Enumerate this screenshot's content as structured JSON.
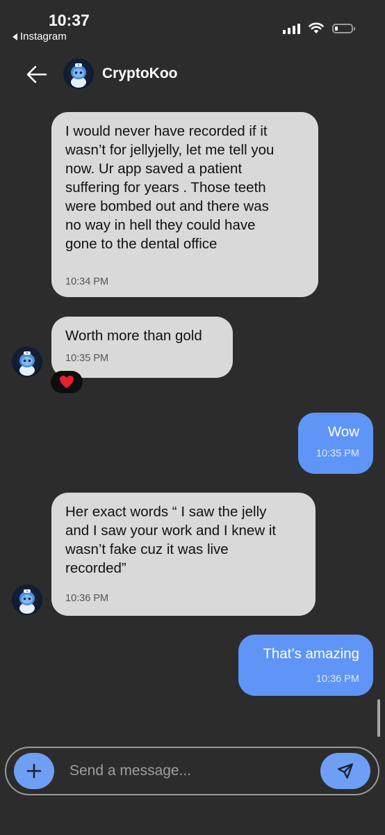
{
  "status_bar": {
    "time": "10:37",
    "back_app": "Instagram"
  },
  "header": {
    "name": "CryptoKoo"
  },
  "messages": [
    {
      "direction": "incoming",
      "text": "I would never have recorded if it\nwasn’t for jellyjelly, let me tell you\nnow. Ur app saved a patient\nsuffering for years . Those teeth\nwere bombed out and there was\nno way in hell they could have\ngone to the dental office",
      "time": "10:34 PM"
    },
    {
      "direction": "incoming",
      "text": "Worth more than gold",
      "time": "10:35 PM",
      "reaction": "❤️"
    },
    {
      "direction": "outgoing",
      "text": "Wow",
      "time": "10:35 PM"
    },
    {
      "direction": "incoming",
      "text": "Her exact words “ I saw the jelly\nand I saw your work and I knew it\nwasn’t fake cuz it was live\nrecorded”",
      "time": "10:36 PM"
    },
    {
      "direction": "outgoing",
      "text": "That’s amazing",
      "time": "10:36 PM"
    }
  ],
  "composer": {
    "placeholder": "Send a message..."
  },
  "colors": {
    "background": "#2c2c2c",
    "incoming_bubble": "#d9d9d9",
    "outgoing_bubble": "#5e95f7",
    "action_button": "#6e9ff4"
  },
  "icons": {
    "back": "arrow-left-icon",
    "add": "plus-icon",
    "send": "paper-plane-icon",
    "signal": "cellular-signal-icon",
    "wifi": "wifi-icon",
    "battery": "battery-icon"
  }
}
